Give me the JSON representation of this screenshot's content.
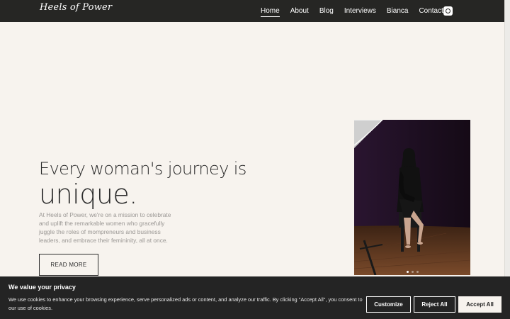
{
  "header": {
    "logo_text": "Heels of Power",
    "nav": [
      {
        "label": "Home",
        "active": true
      },
      {
        "label": "About",
        "active": false
      },
      {
        "label": "Blog",
        "active": false
      },
      {
        "label": "Interviews",
        "active": false
      },
      {
        "label": "Bianca",
        "active": false
      },
      {
        "label": "Contact",
        "active": false
      }
    ],
    "social_icon": "instagram-icon"
  },
  "hero": {
    "title_line1": "Every woman's journey is",
    "title_line2": "unique.",
    "description": "At Heels of Power, we're on a mission to celebrate and uplift the remarkable women who gracefully juggle the roles of mompreneurs and business leaders, and embrace their femininity, all at once.",
    "read_more_label": "READ MORE",
    "carousel": {
      "slide_count": 3,
      "active_slide": 1
    }
  },
  "cookie_banner": {
    "title": "We value your privacy",
    "text": "We use cookies to enhance your browsing experience, serve personalized ads or content, and analyze our traffic. By clicking \"Accept All\", you consent to our use of cookies.",
    "customize_label": "Customize",
    "reject_label": "Reject All",
    "accept_label": "Accept All"
  },
  "colors": {
    "header_bg": "#262624",
    "page_bg": "#f7f3ee",
    "cookie_bg": "#242424"
  }
}
